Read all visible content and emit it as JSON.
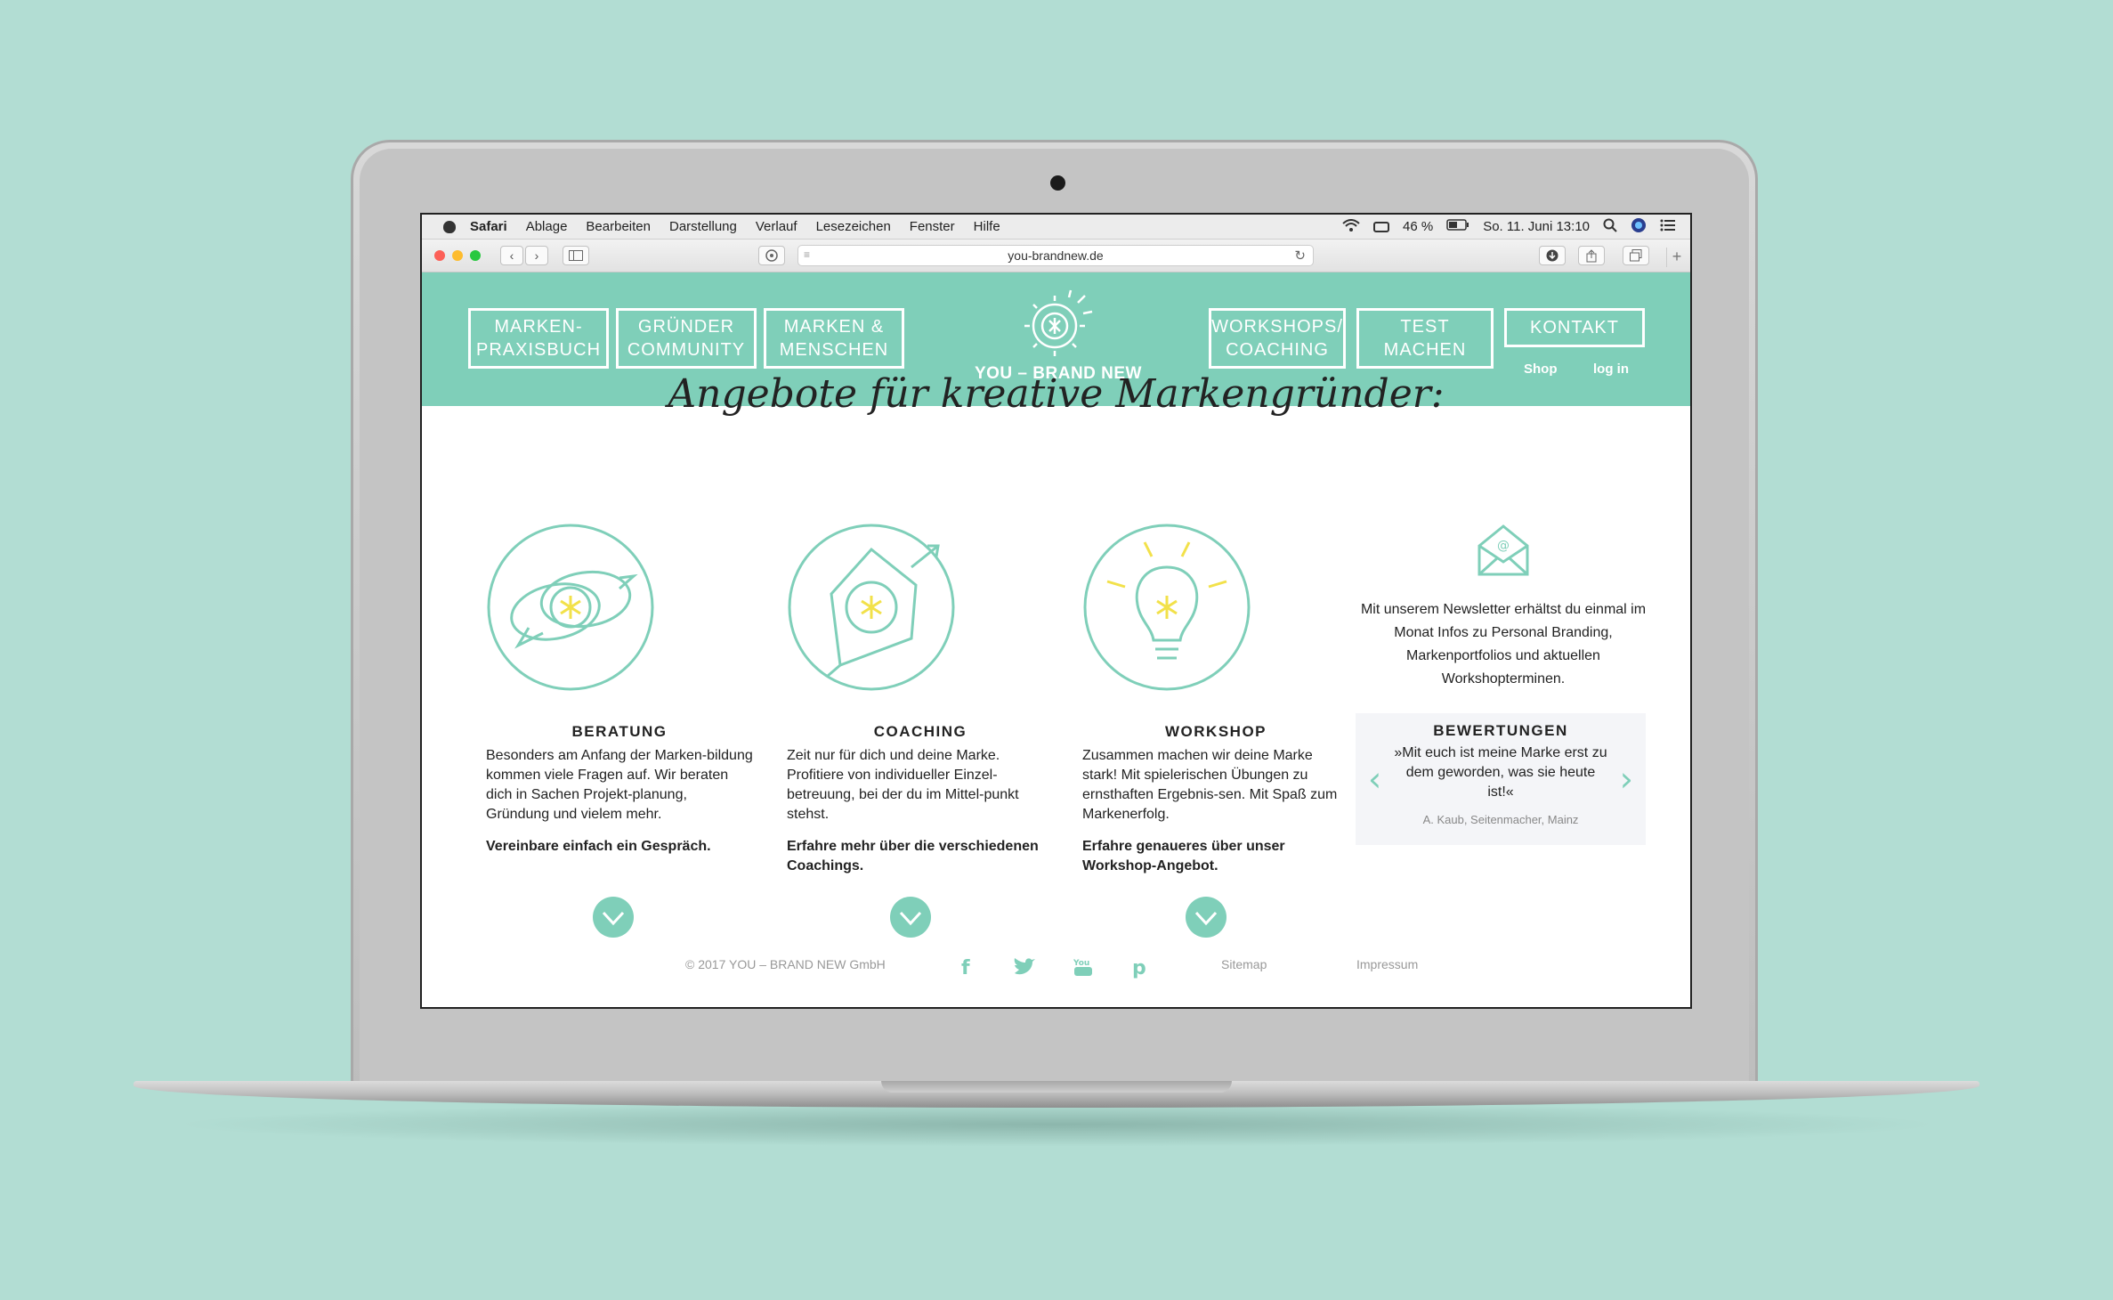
{
  "menubar": {
    "apple_icon": "apple-icon",
    "items": [
      "Safari",
      "Ablage",
      "Bearbeiten",
      "Darstellung",
      "Verlauf",
      "Lesezeichen",
      "Fenster",
      "Hilfe"
    ],
    "battery": "46 %",
    "datetime": "So. 11. Juni 13:10"
  },
  "browser": {
    "url": "you-brandnew.de"
  },
  "site": {
    "nav_left": [
      "MARKEN-\nPRAXISBUCH",
      "GRÜNDER\nCOMMUNITY",
      "MARKEN &\nMENSCHEN"
    ],
    "nav_right": [
      "WORKSHOPS/\nCOACHING",
      "TEST\nMACHEN",
      "KONTAKT"
    ],
    "logo_text": "YOU – BRAND NEW",
    "shop_link": "Shop",
    "login_link": "log in",
    "headline": "Angebote für kreative Markengründer:",
    "columns": [
      {
        "title": "BERATUNG",
        "text": "Besonders am Anfang der Marken-bildung kommen viele Fragen auf. Wir beraten dich in Sachen Projekt-planung, Gründung und vielem mehr.",
        "cta": "Vereinbare einfach ein Gespräch."
      },
      {
        "title": "COACHING",
        "text": "Zeit nur für dich und deine Marke. Profitiere von individueller Einzel-betreuung, bei der du im Mittel-punkt stehst.",
        "cta": "Erfahre mehr über die verschiedenen Coachings."
      },
      {
        "title": "WORKSHOP",
        "text": "Zusammen machen wir deine Marke stark! Mit spielerischen Übungen zu ernsthaften Ergebnis-sen. Mit Spaß zum Markenerfolg.",
        "cta": "Erfahre genaueres über unser Workshop-Angebot."
      }
    ],
    "newsletter": {
      "text": "Mit unserem Newsletter erhältst du einmal im Monat Infos zu Personal Branding, Markenportfolios und aktuellen Workshopterminen."
    },
    "reviews": {
      "title": "BEWERTUNGEN",
      "quote": "»Mit euch ist meine Marke erst zu dem geworden, was sie heute ist!«",
      "author": "A. Kaub, Seitenmacher, Mainz"
    },
    "footer": {
      "copyright": "© 2017 YOU – BRAND NEW GmbH",
      "sitemap": "Sitemap",
      "impressum": "Impressum",
      "social_icons": [
        "facebook-icon",
        "twitter-icon",
        "youtube-icon",
        "pinterest-icon"
      ]
    },
    "colors": {
      "accent": "#7fcfb9",
      "accent_yellow": "#f2e14a",
      "background": "#b2ddd3"
    }
  }
}
